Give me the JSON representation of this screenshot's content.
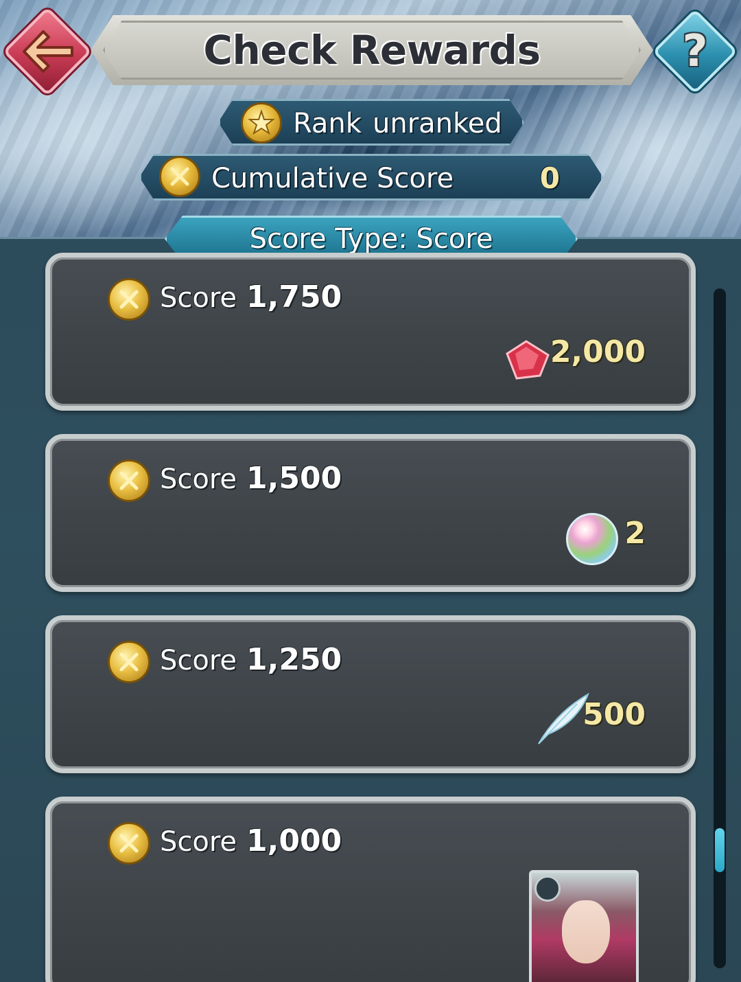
{
  "header": {
    "title": "Check Rewards",
    "help_label": "?"
  },
  "rank": {
    "label": "Rank",
    "value": "unranked"
  },
  "cumulative": {
    "label": "Cumulative Score",
    "value": "0"
  },
  "score_type": {
    "label": "Score Type: Score"
  },
  "rewards": [
    {
      "score_label": "Score",
      "score_value": "1,750",
      "reward_icon": "red-gem-icon",
      "reward_amount": "2,000"
    },
    {
      "score_label": "Score",
      "score_value": "1,500",
      "reward_icon": "rainbow-orb-icon",
      "reward_amount": "2"
    },
    {
      "score_label": "Score",
      "score_value": "1,250",
      "reward_icon": "feather-icon",
      "reward_amount": "500"
    },
    {
      "score_label": "Score",
      "score_value": "1,000",
      "reward_icon": "hero-portrait",
      "reward_amount": ""
    }
  ],
  "scroll": {
    "position": 0.82
  },
  "colors": {
    "accent_gold": "#f5e8a6",
    "back_button": "#c83a54",
    "help_button": "#2b8fae",
    "tab": "#1a6f8a",
    "card_bg": "#3d4347"
  }
}
